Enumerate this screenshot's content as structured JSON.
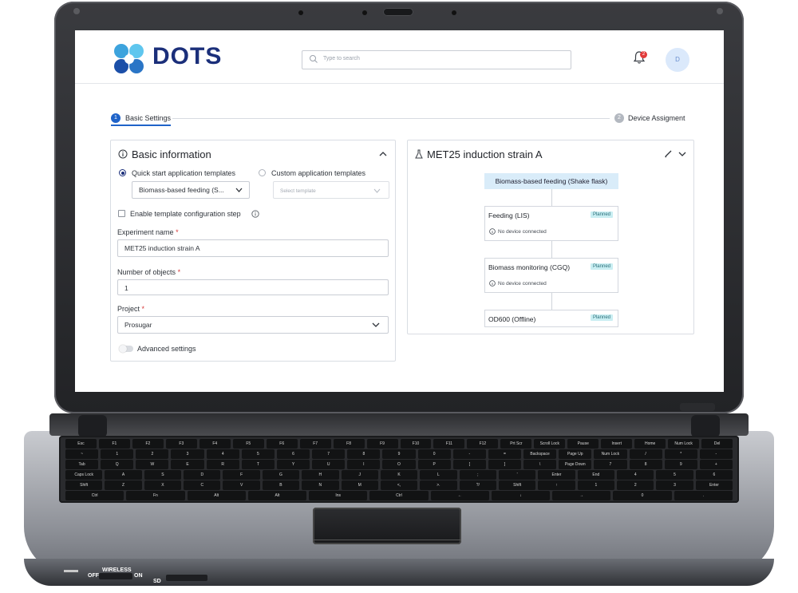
{
  "app": {
    "brand": "DOTS",
    "search": {
      "placeholder": "Type to search"
    },
    "notifications": {
      "count": "2"
    },
    "user": {
      "initial": "D"
    }
  },
  "stepper": {
    "steps": [
      {
        "number": "1",
        "label": "Basic Settings",
        "active": true
      },
      {
        "number": "2",
        "label": "Device Assigment",
        "active": false
      }
    ]
  },
  "basic_info": {
    "title": "Basic information",
    "quick_start_label": "Quick start application templates",
    "custom_label": "Custom application templates",
    "quick_start_value": "Biomass-based feeding (S...",
    "custom_placeholder": "Select template",
    "enable_template_label": "Enable template configuration step",
    "experiment_name_label": "Experiment name",
    "experiment_name_value": "MET25 induction strain A",
    "objects_label": "Number of objects",
    "objects_value": "1",
    "project_label": "Project",
    "project_value": "Prosugar",
    "advanced_label": "Advanced settings",
    "required_mark": "*"
  },
  "preview": {
    "title": "MET25 induction strain A",
    "header_node": "Biomass-based feeding (Shake flask)",
    "nodes": [
      {
        "title": "Feeding (LIS)",
        "status": "Planned",
        "device": "No device connected"
      },
      {
        "title": "Biomass monitoring (CGQ)",
        "status": "Planned",
        "device": "No device connected"
      },
      {
        "title": "OD600 (Offline)",
        "status": "Planned"
      }
    ]
  },
  "laptop": {
    "wireless_label": "WIRELESS",
    "off_label": "OFF",
    "on_label": "ON",
    "sd_label": "SD"
  },
  "keyboard": {
    "rows": [
      [
        "Esc",
        "F1",
        "F2",
        "F3",
        "F4",
        "F5",
        "F6",
        "F7",
        "F8",
        "F9",
        "F10",
        "F11",
        "F12",
        "Prt Scr",
        "Scroll Lock",
        "Pause",
        "Insert",
        "Home",
        "Num Lock",
        "Del"
      ],
      [
        "~",
        "1",
        "2",
        "3",
        "4",
        "5",
        "6",
        "7",
        "8",
        "9",
        "0",
        "-",
        "=",
        "Backspace",
        "Page Up",
        "Num Lock",
        "/",
        "*",
        "-"
      ],
      [
        "Tab",
        "Q",
        "W",
        "E",
        "R",
        "T",
        "Y",
        "U",
        "I",
        "O",
        "P",
        "[",
        "]",
        "\\",
        "Page Down",
        "7",
        "8",
        "9",
        "+"
      ],
      [
        "Caps Lock",
        "A",
        "S",
        "D",
        "F",
        "G",
        "H",
        "J",
        "K",
        "L",
        ";",
        "'",
        "Enter",
        "End",
        "4",
        "5",
        "6"
      ],
      [
        "Shift",
        "Z",
        "X",
        "C",
        "V",
        "B",
        "N",
        "M",
        "<,",
        ">.",
        "?/",
        "Shift",
        "↑",
        "1",
        "2",
        "3",
        "Enter"
      ],
      [
        "Ctrl",
        "Fn",
        "Alt",
        "Alt",
        "Ins",
        "Ctrl",
        "←",
        "↓",
        "→",
        "0",
        "."
      ]
    ]
  },
  "colors": {
    "primary": "#1f63c9",
    "brand_dark": "#1b2f7a",
    "brand_light": "#5fb7e8",
    "planned_bg": "#c9eef2"
  }
}
